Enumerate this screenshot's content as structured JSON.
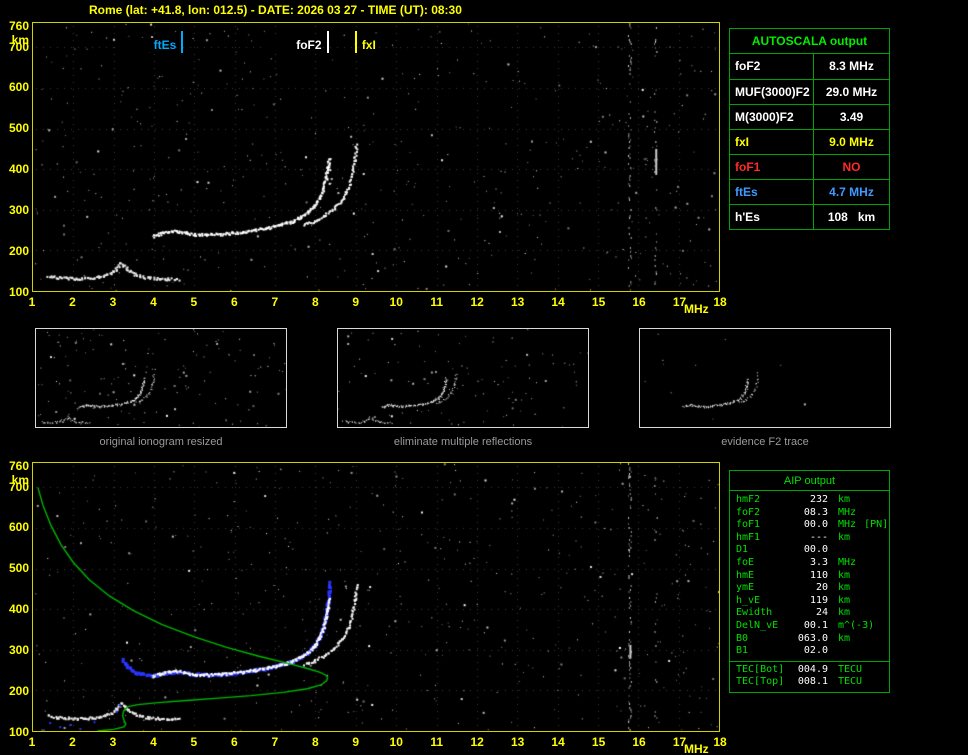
{
  "title": "Rome (lat: +41.8, lon: 012.5) - DATE: 2026 03 27 - TIME (UT): 08:30",
  "colors": {
    "white": "#ffffff",
    "yellow": "#ffff00",
    "red": "#ff2a2a",
    "blue": "#3d9aff",
    "green": "#00e000",
    "table_border": "#00a400",
    "trace_blue": "#2b35ff",
    "profile_green": "#00b800",
    "caption_gray": "#9a9a9a"
  },
  "plot": {
    "y_unit": "km",
    "x_unit": "MHz",
    "x_ticks": [
      "1",
      "2",
      "3",
      "4",
      "5",
      "6",
      "7",
      "8",
      "9",
      "10",
      "11",
      "12",
      "13",
      "14",
      "15",
      "16",
      "17",
      "18"
    ],
    "y_ticks": [
      "760",
      "700",
      "600",
      "500",
      "400",
      "300",
      "200",
      "100"
    ]
  },
  "top_plot": {
    "markers": [
      {
        "label": "ftEs",
        "freq_mhz": 4.7,
        "color": "#00aaff",
        "side": "left"
      },
      {
        "label": "foF2",
        "freq_mhz": 8.3,
        "color": "#ffffff",
        "side": "left"
      },
      {
        "label": "fxI",
        "freq_mhz": 9.0,
        "color": "#ffff00",
        "side": "right"
      }
    ]
  },
  "autoscala_table": {
    "title": "AUTOSCALA output",
    "rows": [
      {
        "label": "foF2",
        "value": "8.3 MHz",
        "color": "white"
      },
      {
        "label": "MUF(3000)F2",
        "value": "29.0 MHz",
        "color": "white"
      },
      {
        "label": "M(3000)F2",
        "value": "3.49",
        "color": "white"
      },
      {
        "label": "fxI",
        "value": "9.0 MHz",
        "color": "yellow"
      },
      {
        "label": "foF1",
        "value": "NO",
        "color": "red"
      },
      {
        "label": "ftEs",
        "value": "4.7 MHz",
        "color": "blue"
      },
      {
        "label": "h'Es",
        "value": "108   km",
        "color": "white"
      }
    ]
  },
  "thumbnails": [
    {
      "caption": "original ionogram resized"
    },
    {
      "caption": "eliminate multiple reflections"
    },
    {
      "caption": "evidence F2 trace"
    }
  ],
  "aip_table": {
    "title": "AIP output",
    "rows": [
      {
        "label": "hmF2",
        "value": "232",
        "unit": "km",
        "note": ""
      },
      {
        "label": "foF2",
        "value": "08.3",
        "unit": "MHz",
        "note": ""
      },
      {
        "label": "foF1",
        "value": "00.0",
        "unit": "MHz",
        "note": "[PN]"
      },
      {
        "label": "hmF1",
        "value": "---",
        "unit": "km",
        "note": ""
      },
      {
        "label": "D1",
        "value": "00.0",
        "unit": "",
        "note": ""
      },
      {
        "label": "foE",
        "value": "3.3",
        "unit": "MHz",
        "note": ""
      },
      {
        "label": "hmE",
        "value": "110",
        "unit": "km",
        "note": ""
      },
      {
        "label": "ymE",
        "value": "20",
        "unit": "km",
        "note": ""
      },
      {
        "label": "h_vE",
        "value": "119",
        "unit": "km",
        "note": ""
      },
      {
        "label": "Ewidth",
        "value": "24",
        "unit": "km",
        "note": ""
      },
      {
        "label": "DelN_vE",
        "value": "00.1",
        "unit": "m^(-3)",
        "note": ""
      },
      {
        "label": "B0",
        "value": "063.0",
        "unit": "km",
        "note": ""
      },
      {
        "label": "B1",
        "value": "02.0",
        "unit": "",
        "note": ""
      }
    ],
    "tec_rows": [
      {
        "label": "TEC[Bot]",
        "value": "004.9",
        "unit": "TECU"
      },
      {
        "label": "TEC[Top]",
        "value": "008.1",
        "unit": "TECU"
      }
    ]
  },
  "chart_data": {
    "type": "scatter",
    "title": "Ionogram, Rome, 2026-03-27 08:30 UT",
    "xlabel": "MHz",
    "ylabel": "km",
    "x_range_mhz": [
      1,
      18
    ],
    "y_range_km": [
      100,
      760
    ],
    "grid": "dotted, 1 MHz x 100 km",
    "scaled_values": {
      "foF2_MHz": 8.3,
      "MUF3000F2_MHz": 29.0,
      "M3000F2": 3.49,
      "fxI_MHz": 9.0,
      "foF1": "NO",
      "ftEs_MHz": 4.7,
      "hpEs_km": 108,
      "hmF2_km": 232,
      "foE_MHz": 3.3,
      "hmE_km": 110
    },
    "o_trace": [
      [
        3.95,
        237
      ],
      [
        4.15,
        243
      ],
      [
        4.35,
        248
      ],
      [
        4.55,
        249
      ],
      [
        4.75,
        245
      ],
      [
        5.0,
        241
      ],
      [
        5.3,
        240
      ],
      [
        5.6,
        241
      ],
      [
        5.9,
        244
      ],
      [
        6.2,
        247
      ],
      [
        6.5,
        252
      ],
      [
        6.8,
        257
      ],
      [
        7.1,
        264
      ],
      [
        7.4,
        273
      ],
      [
        7.6,
        283
      ],
      [
        7.8,
        296
      ],
      [
        7.95,
        310
      ],
      [
        8.08,
        330
      ],
      [
        8.17,
        352
      ],
      [
        8.24,
        378
      ],
      [
        8.29,
        405
      ],
      [
        8.32,
        428
      ]
    ],
    "x_trace": [
      [
        7.7,
        265
      ],
      [
        7.95,
        273
      ],
      [
        8.2,
        287
      ],
      [
        8.45,
        305
      ],
      [
        8.65,
        327
      ],
      [
        8.8,
        355
      ],
      [
        8.9,
        390
      ],
      [
        8.96,
        425
      ],
      [
        9.0,
        462
      ]
    ],
    "es_trace": [
      [
        1.35,
        139
      ],
      [
        1.6,
        135
      ],
      [
        1.85,
        133
      ],
      [
        2.1,
        132
      ],
      [
        2.35,
        133
      ],
      [
        2.6,
        136
      ],
      [
        2.8,
        141
      ],
      [
        2.95,
        147
      ],
      [
        3.05,
        156
      ],
      [
        3.15,
        169
      ],
      [
        3.25,
        163
      ],
      [
        3.35,
        152
      ],
      [
        3.5,
        143
      ],
      [
        3.65,
        138
      ],
      [
        3.85,
        134
      ],
      [
        4.1,
        132
      ],
      [
        4.35,
        131
      ],
      [
        4.6,
        130
      ]
    ],
    "blue_restored_trace": [
      [
        3.2,
        280
      ],
      [
        3.3,
        262
      ],
      [
        3.45,
        250
      ],
      [
        3.65,
        243
      ],
      [
        3.95,
        239
      ],
      [
        4.2,
        244
      ],
      [
        4.45,
        248
      ],
      [
        4.7,
        246
      ],
      [
        5.0,
        242
      ],
      [
        5.3,
        241
      ],
      [
        5.6,
        242
      ],
      [
        5.9,
        245
      ],
      [
        6.2,
        248
      ],
      [
        6.5,
        253
      ],
      [
        6.8,
        258
      ],
      [
        7.1,
        265
      ],
      [
        7.4,
        274
      ],
      [
        7.6,
        284
      ],
      [
        7.8,
        297
      ],
      [
        7.95,
        313
      ],
      [
        8.07,
        333
      ],
      [
        8.16,
        357
      ],
      [
        8.23,
        385
      ],
      [
        8.28,
        415
      ],
      [
        8.31,
        445
      ],
      [
        8.33,
        468
      ]
    ],
    "blue_es_dots": [
      [
        1.25,
        104
      ],
      [
        1.4,
        122
      ],
      [
        1.65,
        112
      ],
      [
        1.9,
        117
      ],
      [
        2.15,
        107
      ],
      [
        2.5,
        124
      ],
      [
        3.05,
        150
      ],
      [
        3.12,
        166
      ]
    ],
    "profile_green": [
      [
        1.12,
        700
      ],
      [
        1.25,
        655
      ],
      [
        1.45,
        605
      ],
      [
        1.7,
        558
      ],
      [
        2.0,
        515
      ],
      [
        2.4,
        472
      ],
      [
        2.9,
        432
      ],
      [
        3.5,
        396
      ],
      [
        4.2,
        362
      ],
      [
        5.0,
        332
      ],
      [
        5.8,
        306
      ],
      [
        6.6,
        284
      ],
      [
        7.3,
        267
      ],
      [
        7.8,
        254
      ],
      [
        8.1,
        245
      ],
      [
        8.25,
        238
      ],
      [
        8.3,
        232
      ],
      [
        8.28,
        224
      ],
      [
        8.15,
        214
      ],
      [
        7.8,
        204
      ],
      [
        7.2,
        195
      ],
      [
        6.4,
        187
      ],
      [
        5.6,
        181
      ],
      [
        4.8,
        175
      ],
      [
        4.1,
        170
      ],
      [
        3.6,
        165
      ],
      [
        3.35,
        160
      ],
      [
        3.25,
        150
      ],
      [
        3.22,
        138
      ],
      [
        3.26,
        126
      ],
      [
        3.3,
        117
      ],
      [
        3.25,
        110
      ],
      [
        3.0,
        104
      ],
      [
        2.6,
        100
      ]
    ],
    "interference_freqs_mhz": [
      15.78,
      16.42
    ],
    "bright_segments_top": [
      {
        "f": 16.42,
        "h1": 386,
        "h2": 450
      }
    ],
    "bright_segments_bottom": [
      {
        "f": 15.78,
        "h1": 278,
        "h2": 312
      }
    ]
  }
}
